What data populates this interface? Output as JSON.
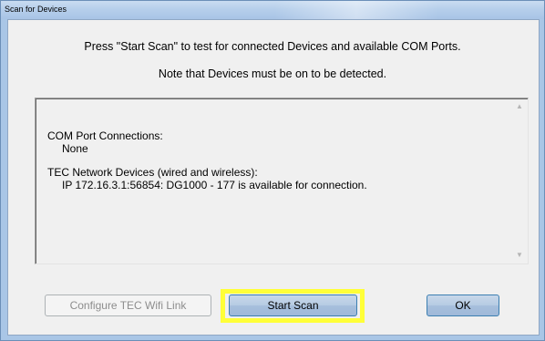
{
  "window": {
    "title": "Scan for Devices"
  },
  "instructions": {
    "line1": "Press \"Start Scan\" to test for connected Devices and available COM Ports.",
    "line2": "Note that Devices must be on to be detected."
  },
  "results": {
    "com_header": "COM Port Connections:",
    "com_value": "None",
    "tec_header": "TEC Network Devices (wired and wireless):",
    "tec_value": "IP 172.16.3.1:56854:  DG1000 - 177 is available for connection."
  },
  "scrollbar": {
    "up_icon": "scroll-up-arrow",
    "down_icon": "scroll-down-arrow"
  },
  "buttons": {
    "configure_label": "Configure TEC Wifi Link",
    "configure_enabled": false,
    "start_label": "Start Scan",
    "ok_label": "OK"
  },
  "colors": {
    "highlight": "#ffff38",
    "window_frame": "#a9c6e6",
    "button_blue": "#b6cbe3"
  }
}
